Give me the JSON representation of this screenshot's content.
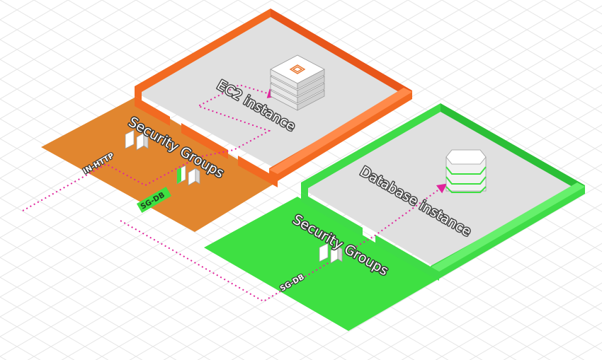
{
  "ec2_zone": {
    "room_label": "EC2 instance",
    "sg_label": "Security Groups",
    "rules": [
      "IN-HTTP",
      "SG-DB"
    ],
    "floor_color": "#e1862f",
    "wall_color": "#f26a21",
    "icon": "ec2-server-stack-icon"
  },
  "db_zone": {
    "room_label": "Database instance",
    "sg_label": "Security Groups",
    "rules": [
      "SG-DB"
    ],
    "floor_color": "#3ee042",
    "wall_color": "#3fdc47",
    "icon": "database-cylinder-icon"
  },
  "connection_color": "#e0259c"
}
